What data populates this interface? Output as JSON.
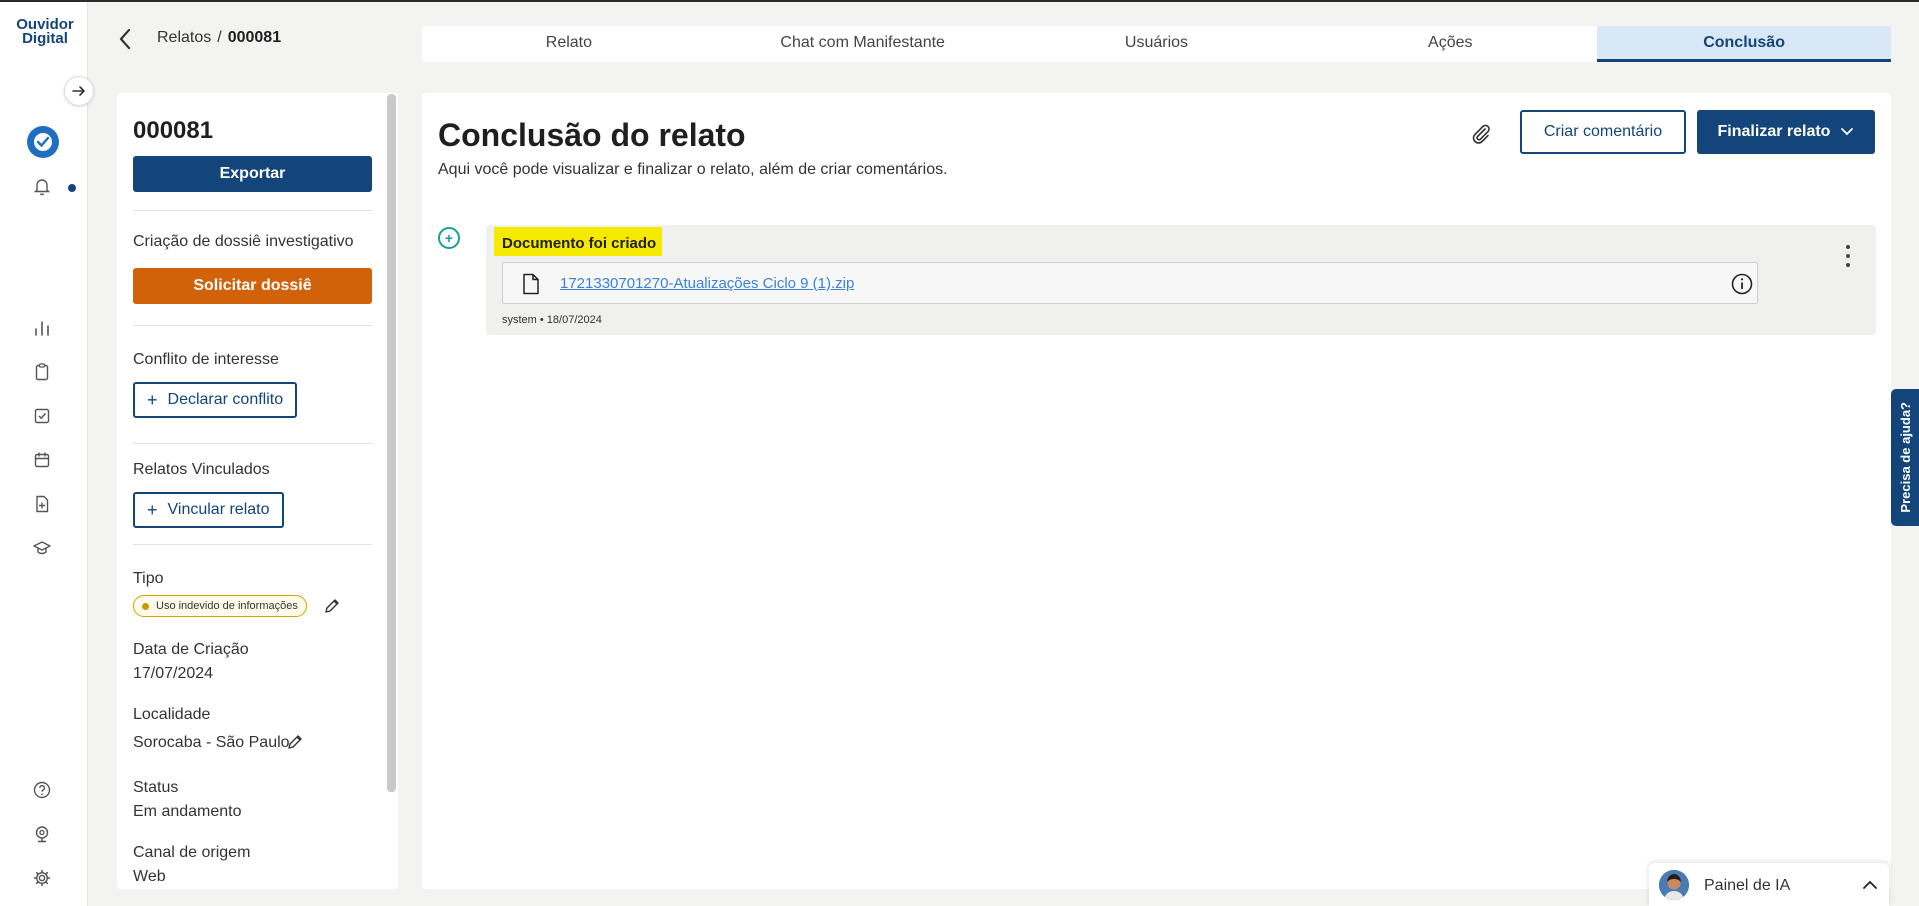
{
  "brand": {
    "logo_line1": "Ouvidor",
    "logo_line2": "Digital"
  },
  "breadcrumb": {
    "parent": "Relatos",
    "separator": "/",
    "current": "000081"
  },
  "tabs": [
    {
      "label": "Relato"
    },
    {
      "label": "Chat com Manifestante"
    },
    {
      "label": "Usuários"
    },
    {
      "label": "Ações"
    },
    {
      "label": "Conclusão"
    }
  ],
  "sidebar": {
    "report_id": "000081",
    "export_label": "Exportar",
    "dossie_section": "Criação de dossiê investigativo",
    "dossie_button": "Solicitar dossiê",
    "conflict_section": "Conflito de interesse",
    "conflict_button": "Declarar conflito",
    "linked_section": "Relatos Vinculados",
    "linked_button": "Vincular relato",
    "plus": "+",
    "tipo_label": "Tipo",
    "tipo_value": "Uso indevido de informações",
    "data_label": "Data de Criação",
    "data_value": "17/07/2024",
    "local_label": "Localidade",
    "local_value": "Sorocaba - São Paulo",
    "status_label": "Status",
    "status_value": "Em andamento",
    "canal_label": "Canal de origem",
    "canal_value": "Web"
  },
  "main": {
    "title": "Conclusão do relato",
    "subtitle": "Aqui você pode visualizar e finalizar o relato, além de criar comentários.",
    "comment_button": "Criar comentário",
    "finalize_button": "Finalizar relato",
    "timeline_marker": "+",
    "event": {
      "title": "Documento foi criado",
      "file_name": "1721330701270-Atualizações Ciclo 9 (1).zip",
      "meta": "system • 18/07/2024"
    }
  },
  "help": {
    "label": "Precisa de ajuda?"
  },
  "ia_panel": {
    "label": "Painel de IA"
  },
  "colors": {
    "primary": "#13457a",
    "orange": "#d2620a",
    "highlight": "#f5e900",
    "teal": "#1b9e97",
    "link": "#3b82d6"
  }
}
